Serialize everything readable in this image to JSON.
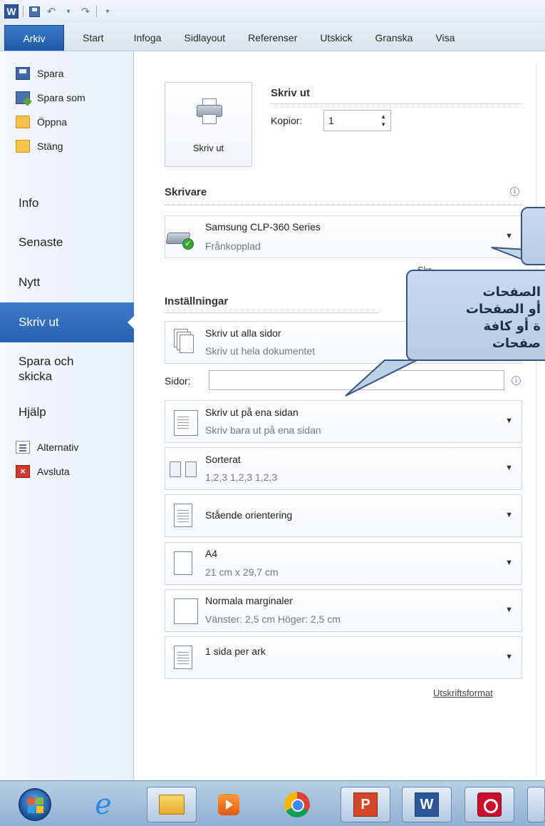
{
  "app": {
    "logo_letter": "W"
  },
  "ribbon": {
    "tabs": [
      {
        "label": "Arkiv"
      },
      {
        "label": "Start"
      },
      {
        "label": "Infoga"
      },
      {
        "label": "Sidlayout"
      },
      {
        "label": "Referenser"
      },
      {
        "label": "Utskick"
      },
      {
        "label": "Granska"
      },
      {
        "label": "Visa"
      }
    ]
  },
  "backstage_nav": {
    "spara": "Spara",
    "spara_som": "Spara som",
    "oppna": "Öppna",
    "stang": "Stäng",
    "info": "Info",
    "senaste": "Senaste",
    "nytt": "Nytt",
    "skriv_ut": "Skriv ut",
    "spara_och_skicka_1": "Spara och",
    "spara_och_skicka_2": "skicka",
    "hjalp": "Hjälp",
    "alternativ": "Alternativ",
    "avsluta": "Avsluta"
  },
  "print": {
    "button_label": "Skriv ut",
    "section_title": "Skriv ut",
    "copies_label": "Kopior:",
    "copies_value": "1"
  },
  "printer": {
    "section_title": "Skrivare",
    "name": "Samsung CLP-360 Series",
    "status": "Frånkopplad",
    "properties_link_partial": "Skr"
  },
  "settings": {
    "section_title": "Inställningar",
    "pages_label": "Sidor:",
    "pages_value": "",
    "items": [
      {
        "line1": "Skriv ut alla sidor",
        "line2": "Skriv ut hela dokumentet"
      },
      {
        "line1": "Skriv ut på ena sidan",
        "line2": "Skriv bara ut på ena sidan"
      },
      {
        "line1": "Sorterat",
        "line2": "1,2,3   1,2,3   1,2,3"
      },
      {
        "line1": "Stående orientering",
        "line2": ""
      },
      {
        "line1": "A4",
        "line2": "21 cm x 29,7 cm"
      },
      {
        "line1": "Normala marginaler",
        "line2": "Vänster: 2,5 cm   Höger: 2,5 cm"
      },
      {
        "line1": "1 sida per ark",
        "line2": ""
      }
    ],
    "page_setup_link": "Utskriftsformat"
  },
  "callouts": {
    "bottom_lines": [
      "الصفحات",
      "أو الصفحات",
      "ة أو كافة",
      "صفحات"
    ]
  },
  "taskbar": {
    "items": [
      "start-orb",
      "internet-explorer",
      "file-explorer",
      "media-player",
      "chrome",
      "powerpoint",
      "word",
      "adobe-creative-cloud"
    ],
    "ppt_letter": "P",
    "word_letter": "W"
  }
}
